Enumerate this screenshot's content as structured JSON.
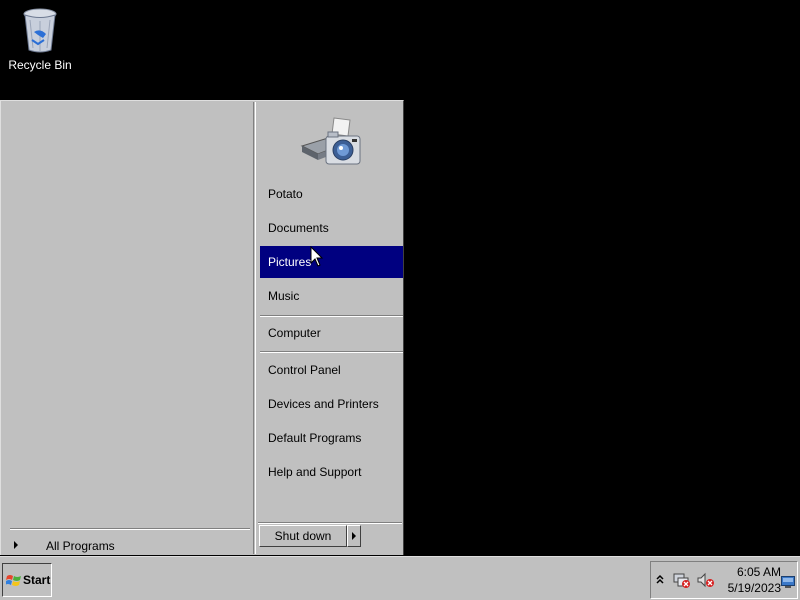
{
  "desktop": {
    "icons": [
      {
        "label": "Recycle Bin",
        "icon": "recycle-bin-icon"
      }
    ]
  },
  "start_menu": {
    "user_picture": "printer-camera-icon",
    "right_items": [
      {
        "label": "Potato",
        "selected": false
      },
      {
        "label": "Documents",
        "selected": false
      },
      {
        "label": "Pictures",
        "selected": true
      },
      {
        "label": "Music",
        "selected": false
      },
      {
        "label": "Computer",
        "selected": false
      },
      {
        "label": "Control Panel",
        "selected": false
      },
      {
        "label": "Devices and Printers",
        "selected": false
      },
      {
        "label": "Default Programs",
        "selected": false
      },
      {
        "label": "Help and Support",
        "selected": false
      }
    ],
    "all_programs_label": "All Programs",
    "shutdown_label": "Shut down"
  },
  "taskbar": {
    "start_label": "Start",
    "clock": {
      "time": "6:05 AM",
      "date": "5/19/2023"
    }
  },
  "colors": {
    "highlight": "#000080",
    "face": "#c0c0c0",
    "desktop": "#000000"
  }
}
